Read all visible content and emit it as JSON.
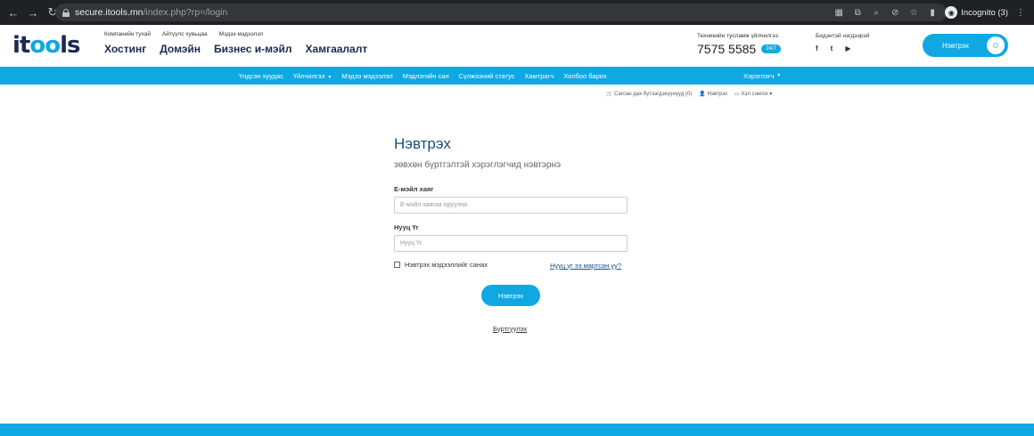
{
  "browser": {
    "url_host": "secure.itools.mn",
    "url_path": "/index.php?rp=/login",
    "profile": "Incognito (3)"
  },
  "header": {
    "logo_prefix": "it",
    "logo_mid": "oo",
    "logo_suffix": "ls",
    "top_links": [
      "Компанийн тухай",
      "Айтүүлс хувьцаа",
      "Мэдээ мэдээлэл"
    ],
    "main_links": [
      "Хостинг",
      "Домэйн",
      "Бизнес и-мэйл",
      "Хамгаалалт"
    ],
    "support_label": "Техникийн тусламж үйлчилгээ",
    "support_phone": "7575 5585",
    "support_badge": "24/7",
    "social_label": "Бидэнтэй нэгдээрэй",
    "social_icons": [
      "f",
      "t",
      "▶"
    ],
    "login_label": "Нэвтрэх"
  },
  "navbar": {
    "items": [
      "Үндсэн хуудас",
      "Үйлчилгээ",
      "Мэдээ мэдээлэл",
      "Мэдлэгийн сан",
      "Сүлжээний статус",
      "Хамтрагч",
      "Холбоо барих"
    ],
    "right": "Хэрэглэгч"
  },
  "subbar": {
    "cart": "Сагсан дах бүтээгдэхүүнүүд (0)",
    "login": "Нэвтрэх",
    "language": "Хэл сонгох"
  },
  "form": {
    "title": "Нэвтрэх",
    "subtitle": "зөвхөн бүртгэлтэй хэрэглэгчид нэвтэрнэ",
    "email_label": "Е-мэйл хаяг",
    "email_placeholder": "Е-мэйл хаягаа оруулна",
    "password_label": "Нууц Үг",
    "password_placeholder": "Нууц Үг",
    "remember_label": "Нэвтрэх мэдээллийг санах",
    "forgot_label": "Нууц үг ээ мартсан уу?",
    "submit_label": "Нэвтрэх",
    "register_label": "Бүртгүүлэх"
  },
  "colors": {
    "accent": "#0fa8e3",
    "brand_dark": "#1a2a55"
  }
}
